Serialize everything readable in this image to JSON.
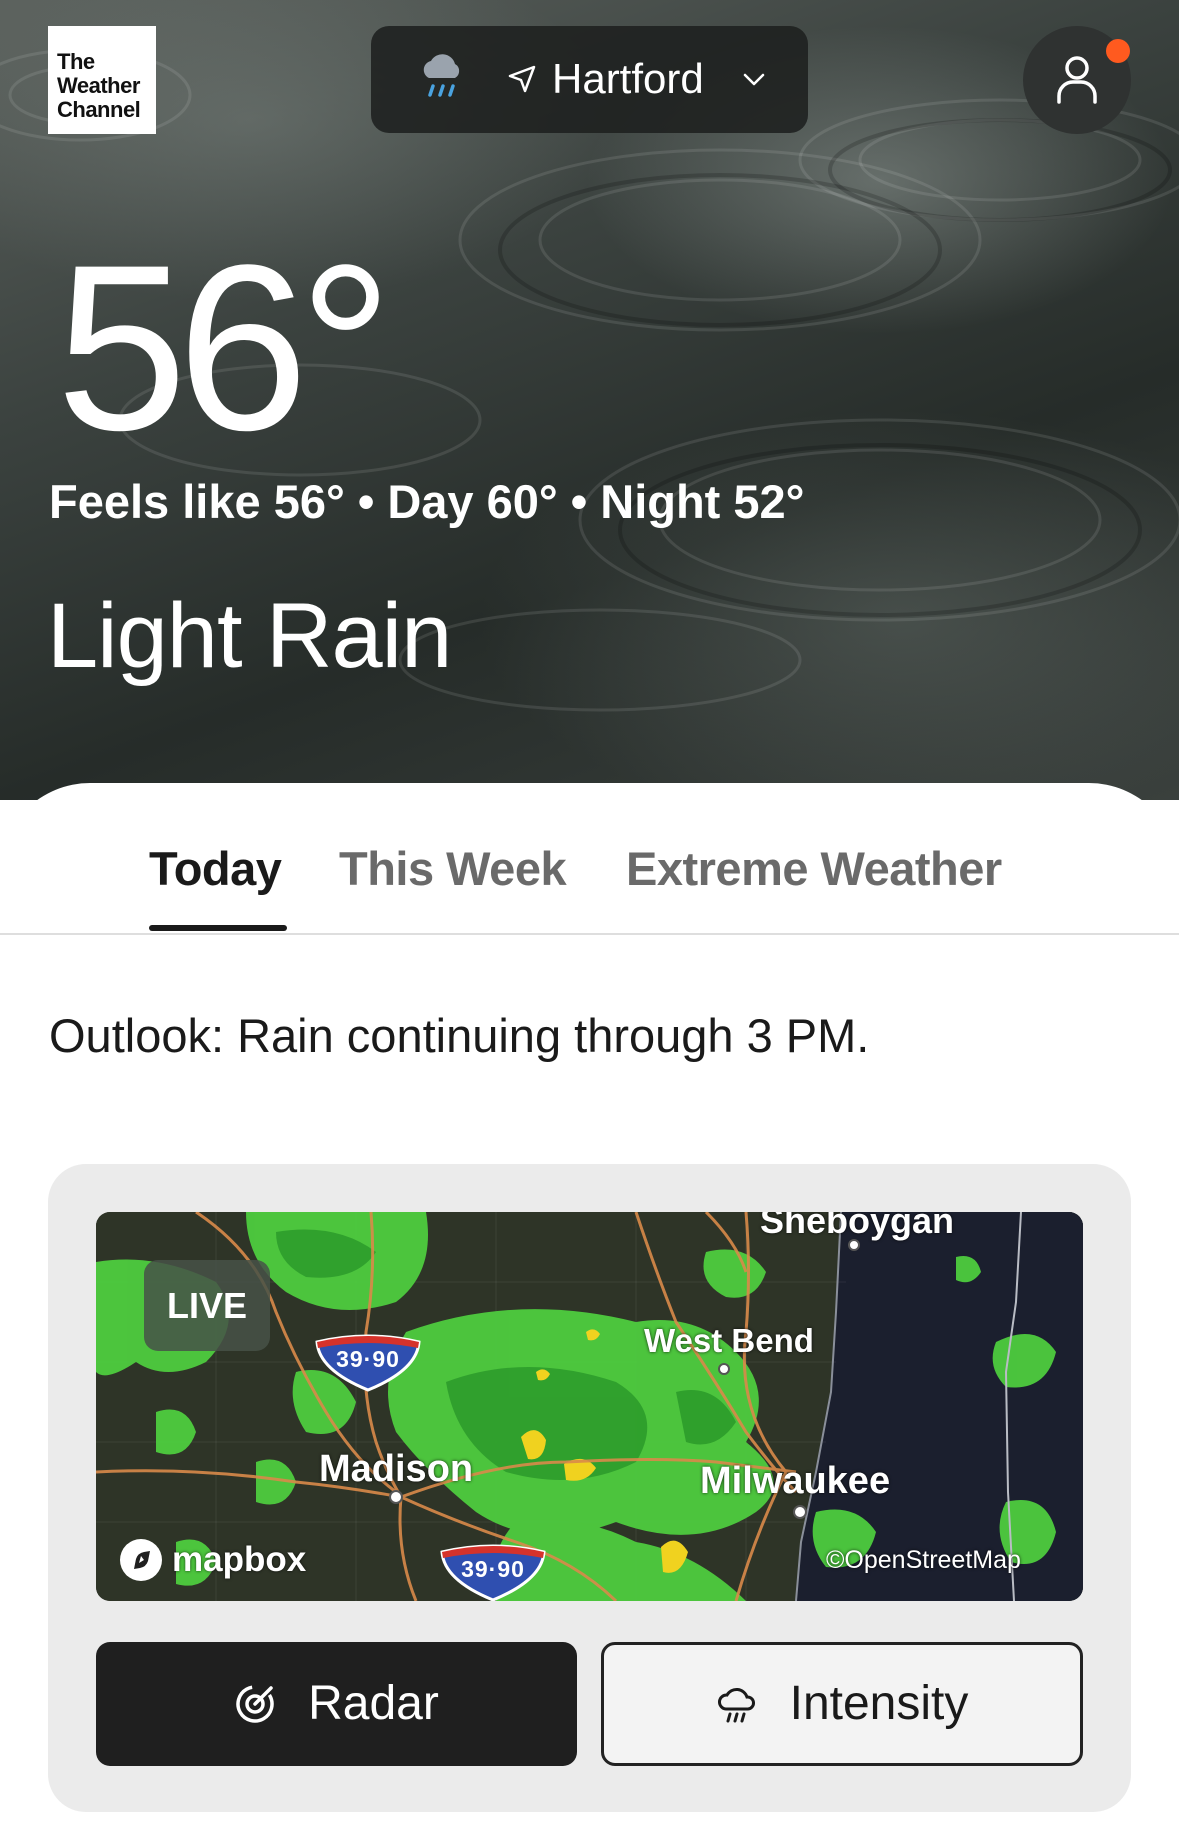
{
  "brand": {
    "logo_lines": [
      "The",
      "Weather",
      "Channel"
    ]
  },
  "header": {
    "location": "Hartford",
    "weather_icon": "rain-cloud-icon",
    "location_icon": "navigation-arrow-icon",
    "dropdown_icon": "chevron-down-icon",
    "profile_icon": "user-icon",
    "notification_color": "#ff5a1f"
  },
  "current": {
    "temperature": "56°",
    "details": "Feels like 56° • Day 60° • Night 52°",
    "condition": "Light Rain"
  },
  "tabs": [
    {
      "label": "Today",
      "active": true
    },
    {
      "label": "This Week",
      "active": false
    },
    {
      "label": "Extreme Weather",
      "active": false
    }
  ],
  "outlook": "Outlook: Rain continuing through 3 PM.",
  "radar_map": {
    "badge": "LIVE",
    "cities": {
      "sheboygan": "Sheboygan",
      "west_bend": "West Bend",
      "madison": "Madison",
      "milwaukee": "Milwaukee"
    },
    "highway_shield": "39·90",
    "mapbox_label": "mapbox",
    "attribution": "©OpenStreetMap",
    "precip_colors": {
      "light": "#4fd13f",
      "heavy": "#f0d21f"
    }
  },
  "buttons": {
    "radar": {
      "label": "Radar",
      "icon": "radar-icon"
    },
    "intensity": {
      "label": "Intensity",
      "icon": "rain-cloud-icon"
    }
  }
}
